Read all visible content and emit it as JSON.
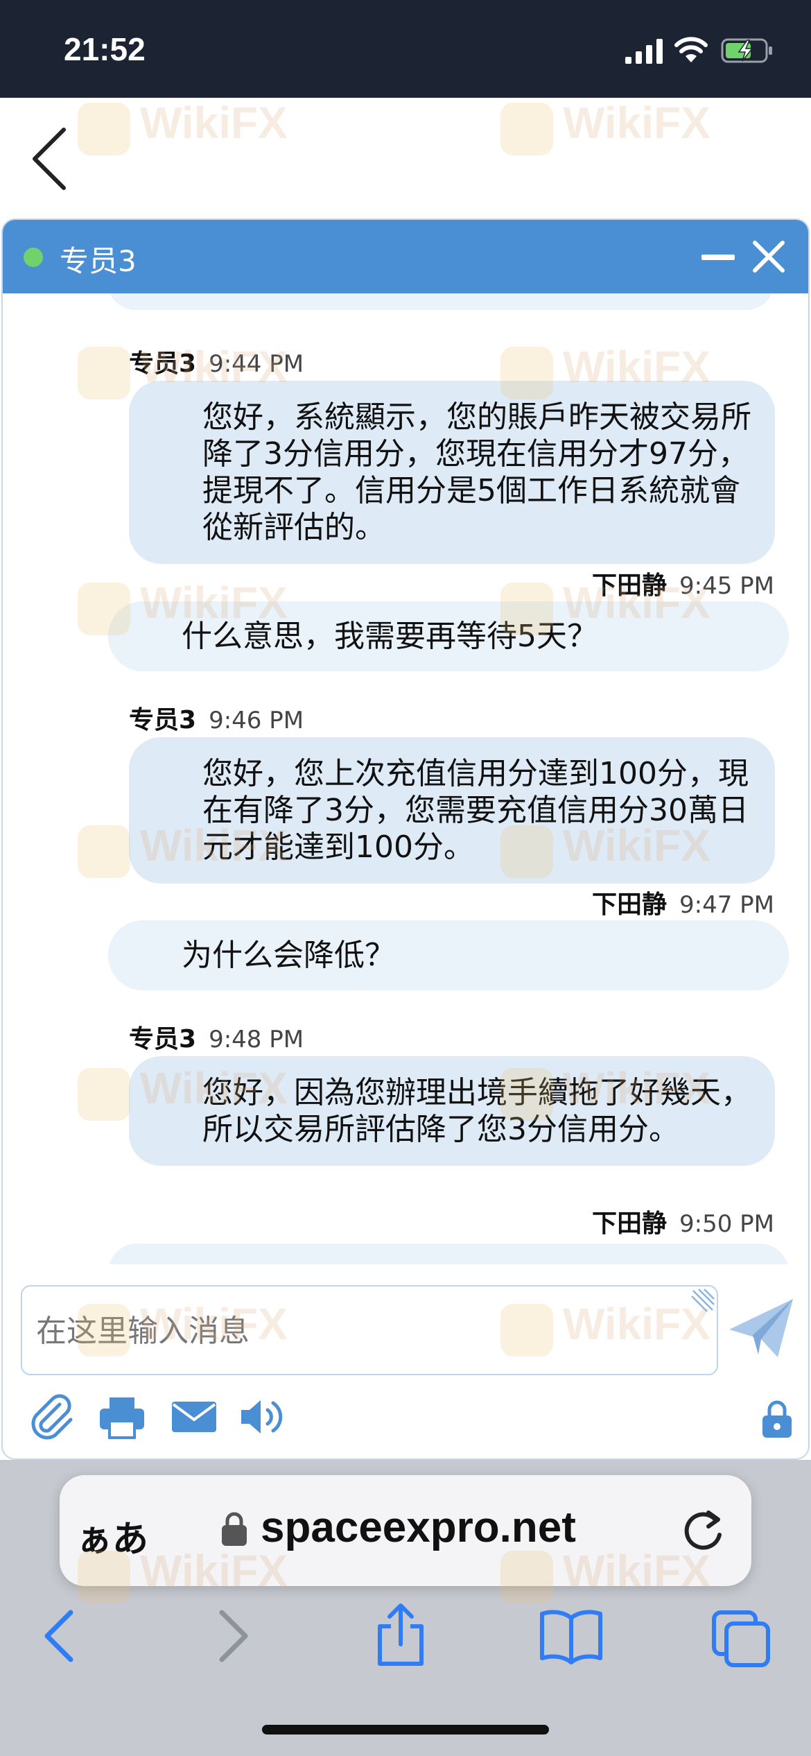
{
  "status_bar": {
    "time": "21:52"
  },
  "chat": {
    "agent_name": "专员3",
    "messages": [
      {
        "sender": "专员3",
        "time": "9:44 PM",
        "text": "您好，系統顯示，您的賬戶昨天被交易所降了3分信用分，您現在信用分才97分，提現不了。信用分是5個工作日系統就會從新評估的。"
      },
      {
        "sender": "下田静",
        "time": "9:45 PM",
        "text": "什么意思，我需要再等待5天？"
      },
      {
        "sender": "专员3",
        "time": "9:46 PM",
        "text": "您好，您上次充值信用分達到100分，現在有降了3分，您需要充值信用分30萬日元才能達到100分。"
      },
      {
        "sender": "下田静",
        "time": "9:47 PM",
        "text": "为什么会降低？"
      },
      {
        "sender": "专员3",
        "time": "9:48 PM",
        "text": "您好，因為您辦理出境手續拖了好幾天，所以交易所評估降了您3分信用分。"
      },
      {
        "sender": "下田静",
        "time": "9:50 PM",
        "text": ""
      }
    ],
    "composer_placeholder": "在这里输入消息"
  },
  "browser": {
    "text_size_label": "ぁあ",
    "url": "spaceexpro.net"
  },
  "watermark": "WikiFX",
  "colors": {
    "header_blue": "#4a8fd4",
    "bubble": "#deebf6",
    "status_bar": "#1c2433",
    "online": "#6fd26a",
    "ios_blue": "#2f7cf6"
  }
}
